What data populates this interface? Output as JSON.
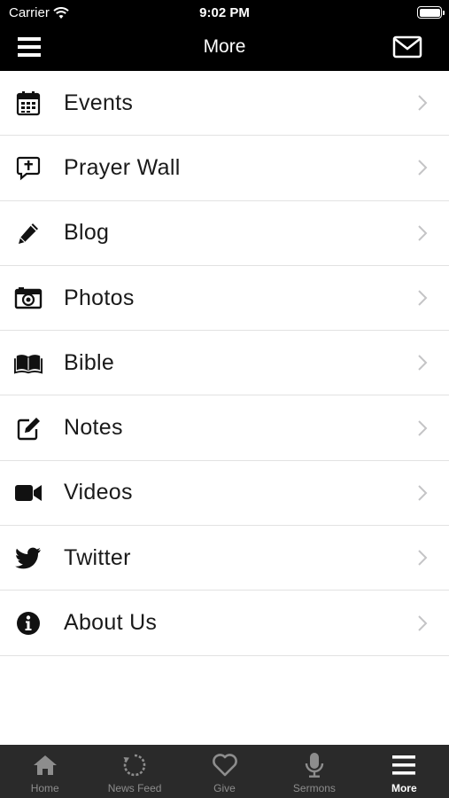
{
  "status_bar": {
    "carrier": "Carrier",
    "time": "9:02 PM"
  },
  "nav": {
    "title": "More"
  },
  "menu_items": [
    {
      "label": "Events",
      "icon": "calendar-icon"
    },
    {
      "label": "Prayer Wall",
      "icon": "prayer-bubble-icon"
    },
    {
      "label": "Blog",
      "icon": "pencil-icon"
    },
    {
      "label": "Photos",
      "icon": "camera-icon"
    },
    {
      "label": "Bible",
      "icon": "book-icon"
    },
    {
      "label": "Notes",
      "icon": "edit-note-icon"
    },
    {
      "label": "Videos",
      "icon": "video-camera-icon"
    },
    {
      "label": "Twitter",
      "icon": "twitter-icon"
    },
    {
      "label": "About Us",
      "icon": "info-icon"
    }
  ],
  "tabs": [
    {
      "label": "Home",
      "icon": "home-icon"
    },
    {
      "label": "News Feed",
      "icon": "refresh-icon"
    },
    {
      "label": "Give",
      "icon": "heart-icon"
    },
    {
      "label": "Sermons",
      "icon": "microphone-icon"
    },
    {
      "label": "More",
      "icon": "hamburger-icon",
      "active": true
    }
  ],
  "colors": {
    "bar_background": "#000000",
    "tab_background": "#2a2a2a",
    "tab_inactive": "#8d8d8d",
    "tab_active": "#ffffff",
    "divider": "#e2e2e2"
  }
}
